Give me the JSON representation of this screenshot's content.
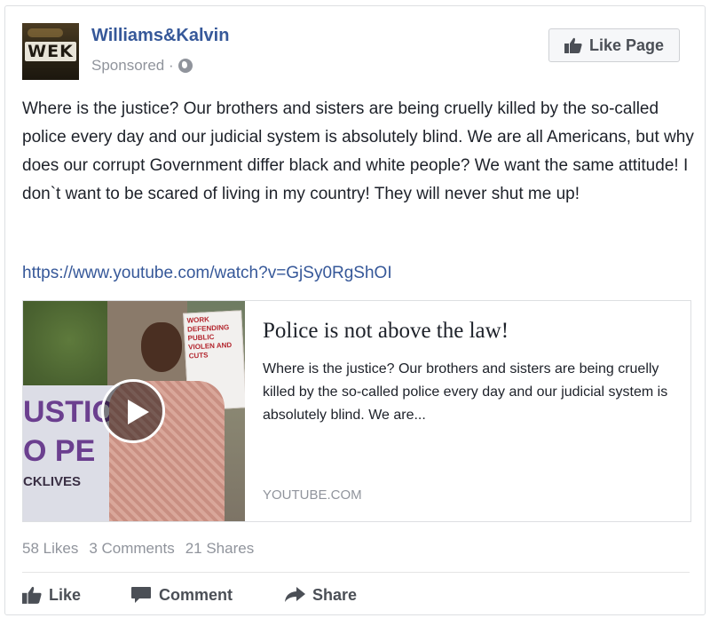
{
  "post": {
    "page_name": "Williams&Kalvin",
    "logo_text": "WEK",
    "sponsored_label": "Sponsored ·",
    "like_page_label": "Like Page",
    "body_text": "Where is the justice? Our brothers and sisters are being cruelly killed by the so-called police every day and our judicial system is absolutely blind. We are all Americans, but why does our corrupt Government differ black and white people? We want the same attitude! I don`t want to be scared of living in my country! They will never shut me up!",
    "link_url": "https://www.youtube.com/watch?v=GjSy0RgShOI"
  },
  "preview": {
    "title": "Police is not above the law!",
    "description": "Where is the justice? Our brothers and sisters are being cruelly killed by the so-called police every day and our judicial system is absolutely blind. We are...",
    "domain": "YOUTUBE.COM",
    "thumbnail_banner_text": "USTIC",
    "thumbnail_banner_text_2": "O PE",
    "thumbnail_banner_text_3": "CKLIVES",
    "thumbnail_sign_text": "WORK DEFENDING PUBLIC VIOLEN AND CUTS"
  },
  "stats": {
    "likes": "58 Likes",
    "comments": "3 Comments",
    "shares": "21 Shares"
  },
  "actions": {
    "like": "Like",
    "comment": "Comment",
    "share": "Share"
  },
  "icons": {
    "thumbs_up": "thumbs-up-icon",
    "globe": "globe-icon",
    "comment": "comment-icon",
    "share": "share-arrow-icon",
    "play": "play-icon"
  },
  "colors": {
    "link_blue": "#365899",
    "meta_gray": "#90949c",
    "text": "#1d2129",
    "action_gray": "#4b4f56"
  }
}
